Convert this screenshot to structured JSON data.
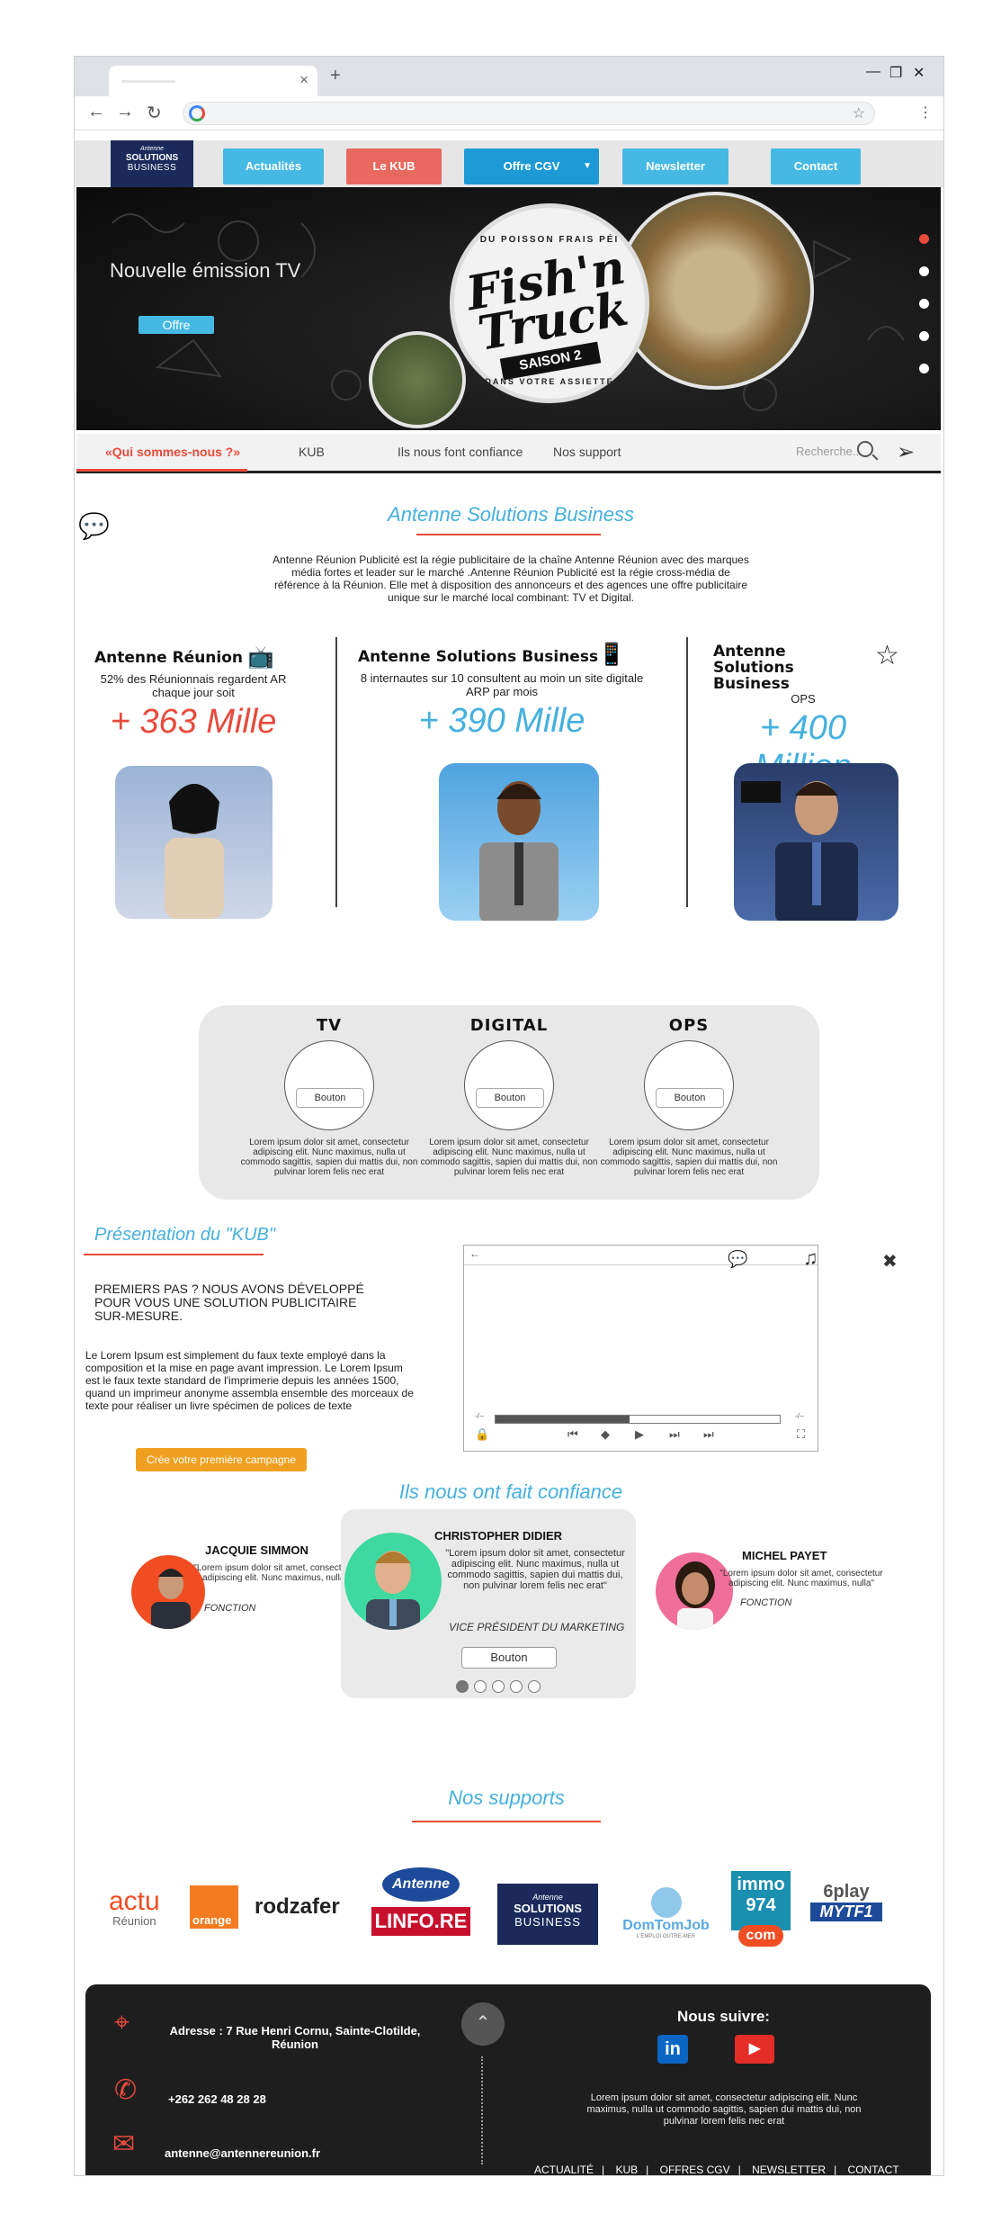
{
  "browser": {
    "new_tab": "+",
    "minimize": "—",
    "restore": "❐",
    "close": "✕"
  },
  "header": {
    "logo": {
      "line1": "Antenne",
      "line2": "SOLUTIONS",
      "line3": "BUSINESS"
    },
    "nav": [
      {
        "label": "Actualités",
        "color": "#45b9e4"
      },
      {
        "label": "Le KUB",
        "color": "#e8695f"
      },
      {
        "label": "Offre CGV",
        "color": "#1d9ad6"
      },
      {
        "label": "Newsletter",
        "color": "#45b9e4"
      },
      {
        "label": "Contact",
        "color": "#45b9e4"
      }
    ]
  },
  "hero": {
    "title": "Nouvelle émission TV",
    "button": "Offre",
    "seal": {
      "top": "DU POISSON FRAIS PÉI",
      "main": "Fish'n Truck",
      "sub": "SAISON 2",
      "bottom": "DANS VOTRE ASSIETTE"
    },
    "slides": 5,
    "active_slide": 1
  },
  "subnav": {
    "items": [
      "«Qui sommes-nous ?»",
      "KUB",
      "Ils nous font confiance",
      "Nos support"
    ],
    "search_placeholder": "Recherche..."
  },
  "about": {
    "title": "Antenne Solutions Business",
    "text": "Antenne Réunion Publicité est la régie publicitaire de la chaîne Antenne Réunion avec des marques média fortes et leader sur le marché .Antenne Réunion Publicité est la régie cross-média de référence à la Réunion. Elle met à disposition des annonceurs et des agences une offre publicitaire unique sur le marché local combinant: TV et Digital."
  },
  "stats": [
    {
      "head": "Antenne Réunion",
      "desc": "52% des Réunionnais regardent AR chaque jour soit",
      "value": "+ 363 Mille",
      "icon": "tv-icon"
    },
    {
      "head": "Antenne Solutions Business",
      "desc": "8 internautes sur 10 consultent au moin un site digitale ARP par mois",
      "value": "+ 390 Mille",
      "icon": "devices-icon"
    },
    {
      "head": "Antenne Solutions Business",
      "desc": "OPS",
      "value": "+ 400 Million",
      "icon": "star-icon"
    }
  ],
  "offers": [
    {
      "title": "TV",
      "button": "Bouton",
      "text": "Lorem ipsum dolor sit amet, consectetur adipiscing elit. Nunc maximus, nulla ut commodo sagittis, sapien dui mattis dui, non pulvinar lorem felis nec erat"
    },
    {
      "title": "DIGITAL",
      "button": "Bouton",
      "text": "Lorem ipsum dolor sit amet, consectetur adipiscing elit. Nunc maximus, nulla ut commodo sagittis, sapien dui mattis dui, non pulvinar lorem felis nec erat"
    },
    {
      "title": "OPS",
      "button": "Bouton",
      "text": "Lorem ipsum dolor sit amet, consectetur adipiscing elit. Nunc maximus, nulla ut commodo sagittis, sapien dui mattis dui, non pulvinar lorem felis nec erat"
    }
  ],
  "kub": {
    "title": "Présentation du \"KUB\"",
    "subtitle": "PREMIERS PAS ? NOUS AVONS DÉVELOPPÉ POUR VOUS UNE SOLUTION PUBLICITAIRE SUR-MESURE.",
    "body": "Le Lorem Ipsum est simplement du faux texte employé dans la composition et la mise en page avant impression. Le Lorem Ipsum est le faux texte standard de l'imprimerie depuis les années 1500, quand un imprimeur anonyme assembla ensemble des morceaux de texte pour réaliser un livre spécimen de polices de texte",
    "cta": "Crée votre première campagne",
    "player_progress": 0.47,
    "player_back": "←",
    "time_left": "-/--",
    "time_right": "-/--"
  },
  "trust": {
    "title": "Ils nous ont fait confiance",
    "left": {
      "name": "JACQUIE SIMMON",
      "text": "\"Lorem ipsum dolor sit amet, consectetur adipiscing elit. Nunc maximus, nulla\"",
      "role": "FONCTION"
    },
    "center": {
      "name": "CHRISTOPHER DIDIER",
      "text": "\"Lorem ipsum dolor sit amet, consectetur adipiscing elit. Nunc maximus, nulla ut commodo sagittis, sapien dui mattis dui, non pulvinar lorem felis nec erat\"",
      "role": "VICE PRÉSIDENT DU MARKETING",
      "button": "Bouton"
    },
    "right": {
      "name": "MICHEL PAYET",
      "text": "\"Lorem ipsum dolor sit amet, consectetur adipiscing elit. Nunc maximus, nulla\"",
      "role": "FONCTION"
    },
    "dots": 5,
    "active_dot": 0
  },
  "supports": {
    "title": "Nos supports",
    "logos": [
      {
        "name": "actu-reunion",
        "line1": "actu",
        "line2": "Réunion"
      },
      {
        "name": "orange",
        "label": "orange"
      },
      {
        "name": "roadzafer",
        "label": "rodzafer"
      },
      {
        "name": "antenne-linfo",
        "line1": "Antenne",
        "line2": "LINFO.RE"
      },
      {
        "name": "solutions-business",
        "line1": "Antenne",
        "line2": "SOLUTIONS",
        "line3": "BUSINESS"
      },
      {
        "name": "domtomjob",
        "label": "DomTomJob",
        "sub": "L'EMPLOI OUTRE-MER"
      },
      {
        "name": "immo974",
        "line1": "immo",
        "line2": "974",
        "line3": "com"
      },
      {
        "name": "6play-mytf1",
        "line1": "6play",
        "line2": "MYTF1"
      }
    ]
  },
  "footer": {
    "address": "Adresse : 7 Rue Henri Cornu, Sainte-Clotilde, Réunion",
    "phone": "+262 262 48 28 28",
    "email": "antenne@antennereunion.fr",
    "follow": "Nous suivre:",
    "linkedin": "in",
    "desc": "Lorem ipsum dolor sit amet, consectetur adipiscing elit. Nunc maximus, nulla ut commodo sagittis, sapien dui mattis dui, non pulvinar lorem felis nec erat",
    "links": [
      "ACTUALITÉ",
      "KUB",
      "OFFRES CGV",
      "NEWSLETTER",
      "CONTACT"
    ]
  }
}
